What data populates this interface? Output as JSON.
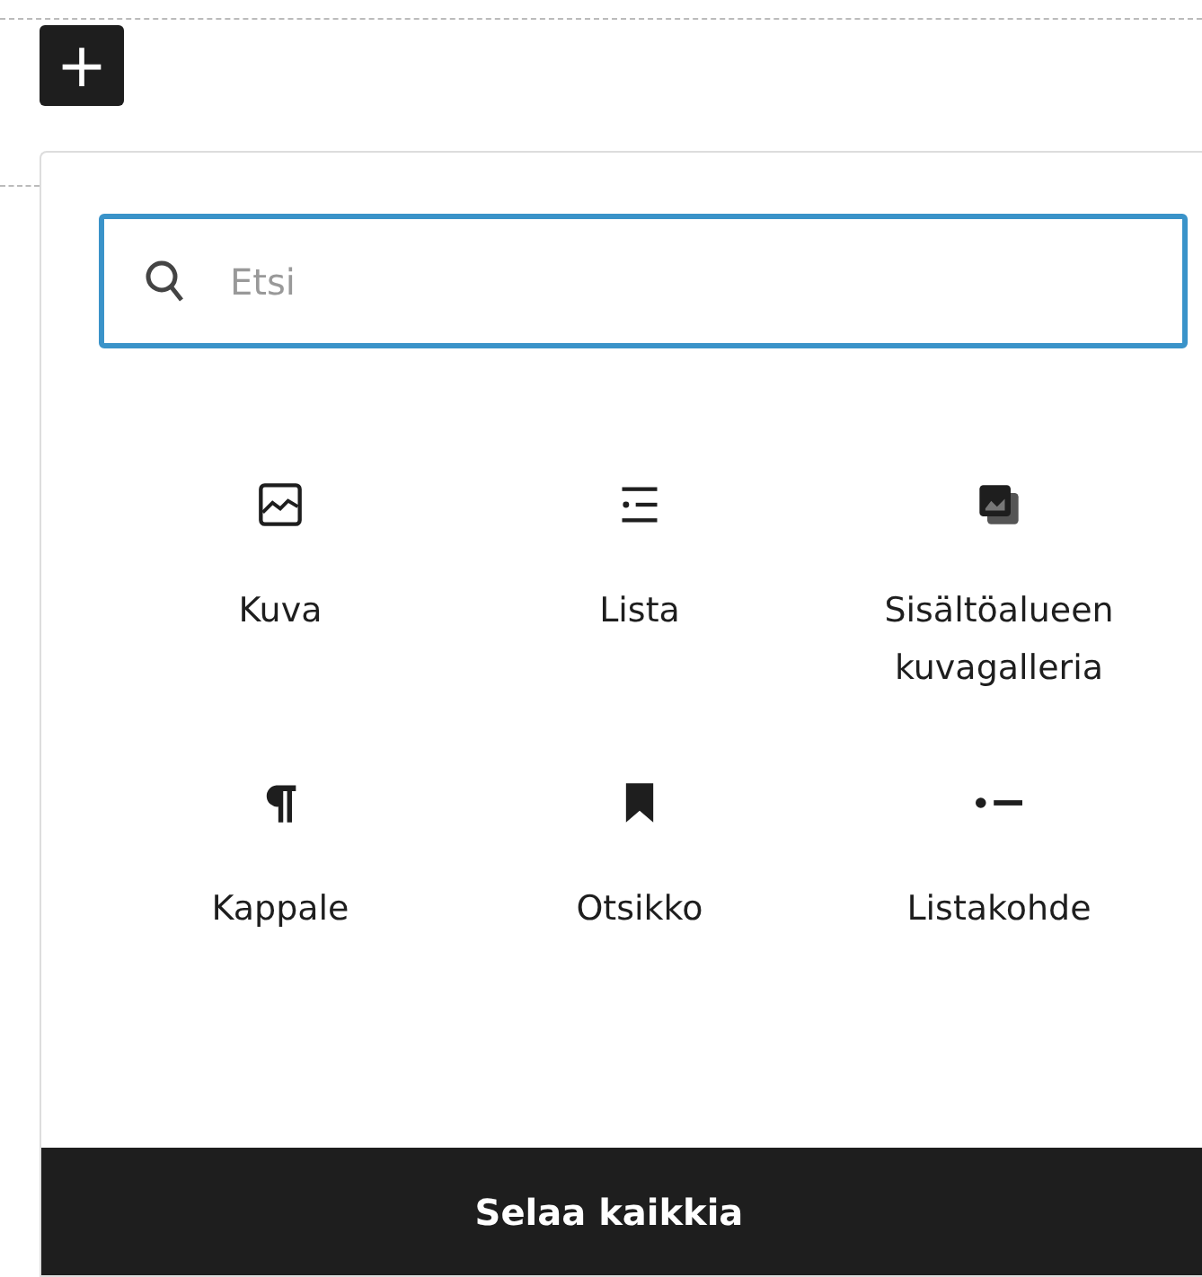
{
  "inserter_button": {
    "label": "+"
  },
  "search": {
    "placeholder": "Etsi"
  },
  "blocks": [
    {
      "kind": "image",
      "label": "Kuva"
    },
    {
      "kind": "list",
      "label": "Lista"
    },
    {
      "kind": "gallery",
      "label": "Sisältöalueen kuvagalleria"
    },
    {
      "kind": "paragraph",
      "label": "Kappale"
    },
    {
      "kind": "heading",
      "label": "Otsikko"
    },
    {
      "kind": "listitem",
      "label": "Listakohde"
    }
  ],
  "footer_button": {
    "label": "Selaa kaikkia"
  }
}
